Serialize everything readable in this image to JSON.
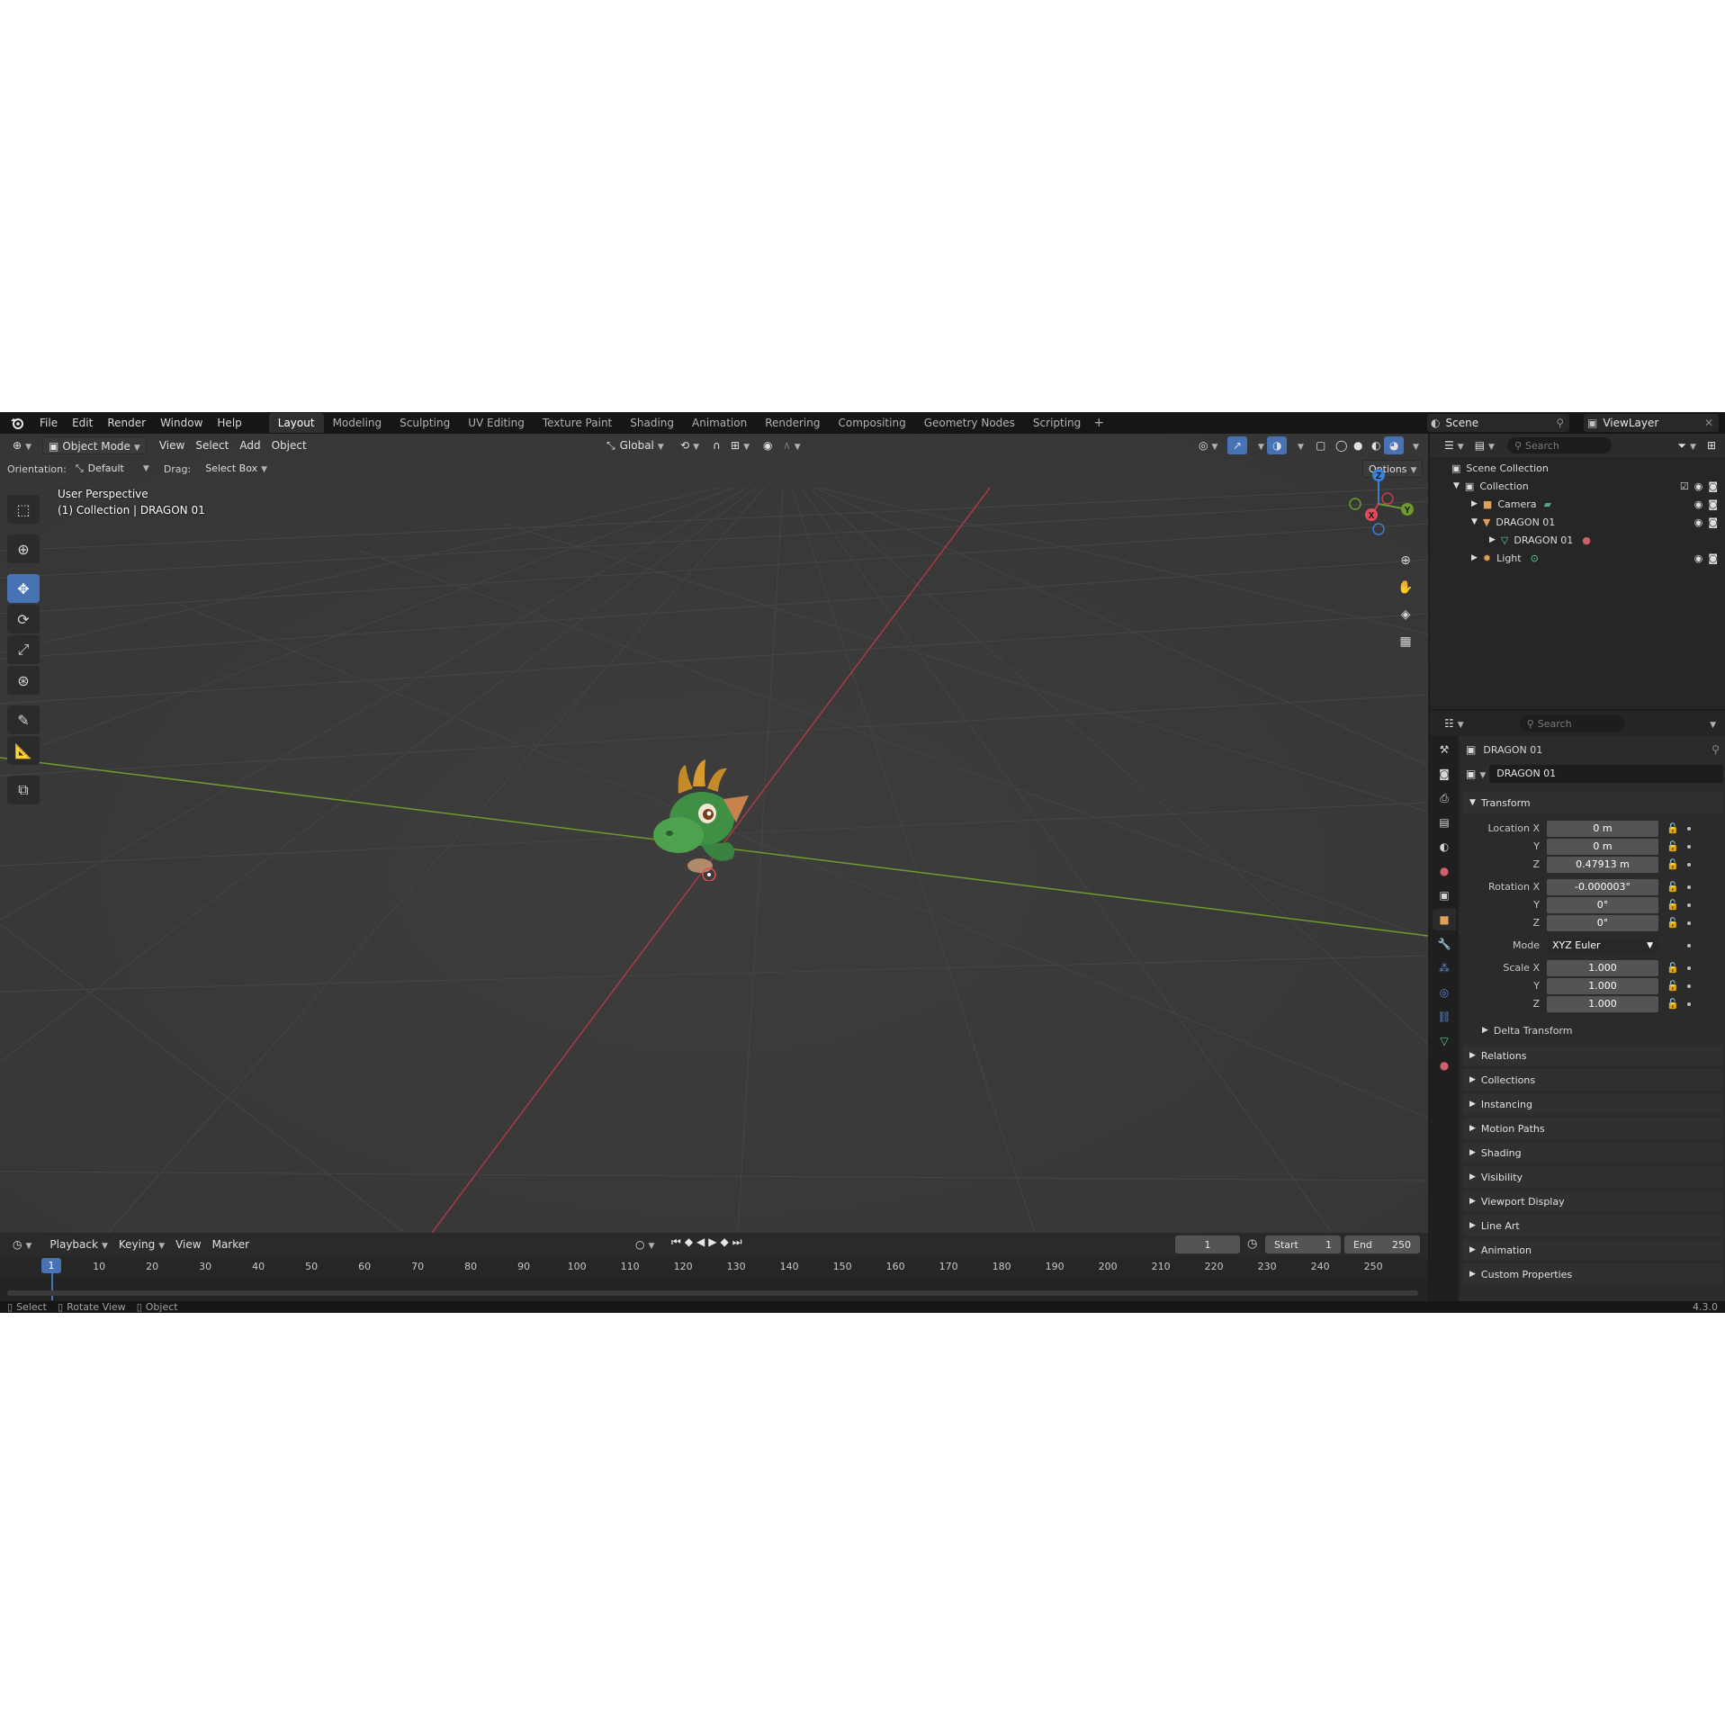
{
  "topbar": {
    "menus": [
      "File",
      "Edit",
      "Render",
      "Window",
      "Help"
    ],
    "workspaces": [
      "Layout",
      "Modeling",
      "Sculpting",
      "UV Editing",
      "Texture Paint",
      "Shading",
      "Animation",
      "Rendering",
      "Compositing",
      "Geometry Nodes",
      "Scripting"
    ],
    "active_workspace": "Layout",
    "add_tab": "+",
    "scene": "Scene",
    "view_layer": "ViewLayer"
  },
  "viewport": {
    "mode": "Object Mode",
    "menus": [
      "View",
      "Select",
      "Add",
      "Object"
    ],
    "orientation_global": "Global",
    "tool_settings": {
      "orientation_label": "Orientation:",
      "orientation_value": "Default",
      "drag_label": "Drag:",
      "drag_value": "Select Box",
      "options": "Options"
    },
    "overlay_line1": "User Perspective",
    "overlay_line2": "(1) Collection | DRAGON 01",
    "gizmo": {
      "x": "X",
      "y": "Y",
      "z": "Z"
    },
    "icons": [
      "select-box-icon",
      "cursor-icon",
      "move-icon",
      "rotate-icon",
      "scale-icon",
      "transform-icon",
      "annotate-icon",
      "measure-icon",
      "add-cube-icon"
    ]
  },
  "timeline": {
    "menus": [
      "Playback",
      "Keying",
      "View",
      "Marker"
    ],
    "current_frame": "1",
    "start_label": "Start",
    "start": "1",
    "end_label": "End",
    "end": "250",
    "ruler": [
      "1",
      "10",
      "20",
      "30",
      "40",
      "50",
      "60",
      "70",
      "80",
      "90",
      "100",
      "110",
      "120",
      "130",
      "140",
      "150",
      "160",
      "170",
      "180",
      "190",
      "200",
      "210",
      "220",
      "230",
      "240",
      "250"
    ]
  },
  "statusbar": {
    "select": "Select",
    "rotate": "Rotate View",
    "object": "Object",
    "version": "4.3.0"
  },
  "outliner": {
    "search_placeholder": "Search",
    "scene_collection": "Scene Collection",
    "collection": "Collection",
    "items": [
      {
        "name": "Camera",
        "icon": "camera-icon"
      },
      {
        "name": "DRAGON 01",
        "icon": "mesh-object-icon"
      },
      {
        "name": "DRAGON 01",
        "icon": "mesh-data-icon"
      },
      {
        "name": "Light",
        "icon": "light-icon"
      }
    ]
  },
  "properties": {
    "search_placeholder": "Search",
    "object_name": "DRAGON 01",
    "datablock_name": "DRAGON 01",
    "transform": {
      "title": "Transform",
      "location_label": "Location X",
      "location": [
        "0 m",
        "0 m",
        "0.47913 m"
      ],
      "rotation_label": "Rotation X",
      "rotation": [
        "-0.000003°",
        "0°",
        "0°"
      ],
      "mode_label": "Mode",
      "mode": "XYZ Euler",
      "scale_label": "Scale X",
      "scale": [
        "1.000",
        "1.000",
        "1.000"
      ],
      "y": "Y",
      "z": "Z",
      "delta": "Delta Transform"
    },
    "panels": [
      "Relations",
      "Collections",
      "Instancing",
      "Motion Paths",
      "Shading",
      "Visibility",
      "Viewport Display",
      "Line Art",
      "Animation",
      "Custom Properties"
    ]
  },
  "colors": {
    "accent": "#4772b3",
    "x_axis": "#c93c4f",
    "y_axis": "#6e9b2e",
    "z_axis": "#3b7fd6"
  }
}
